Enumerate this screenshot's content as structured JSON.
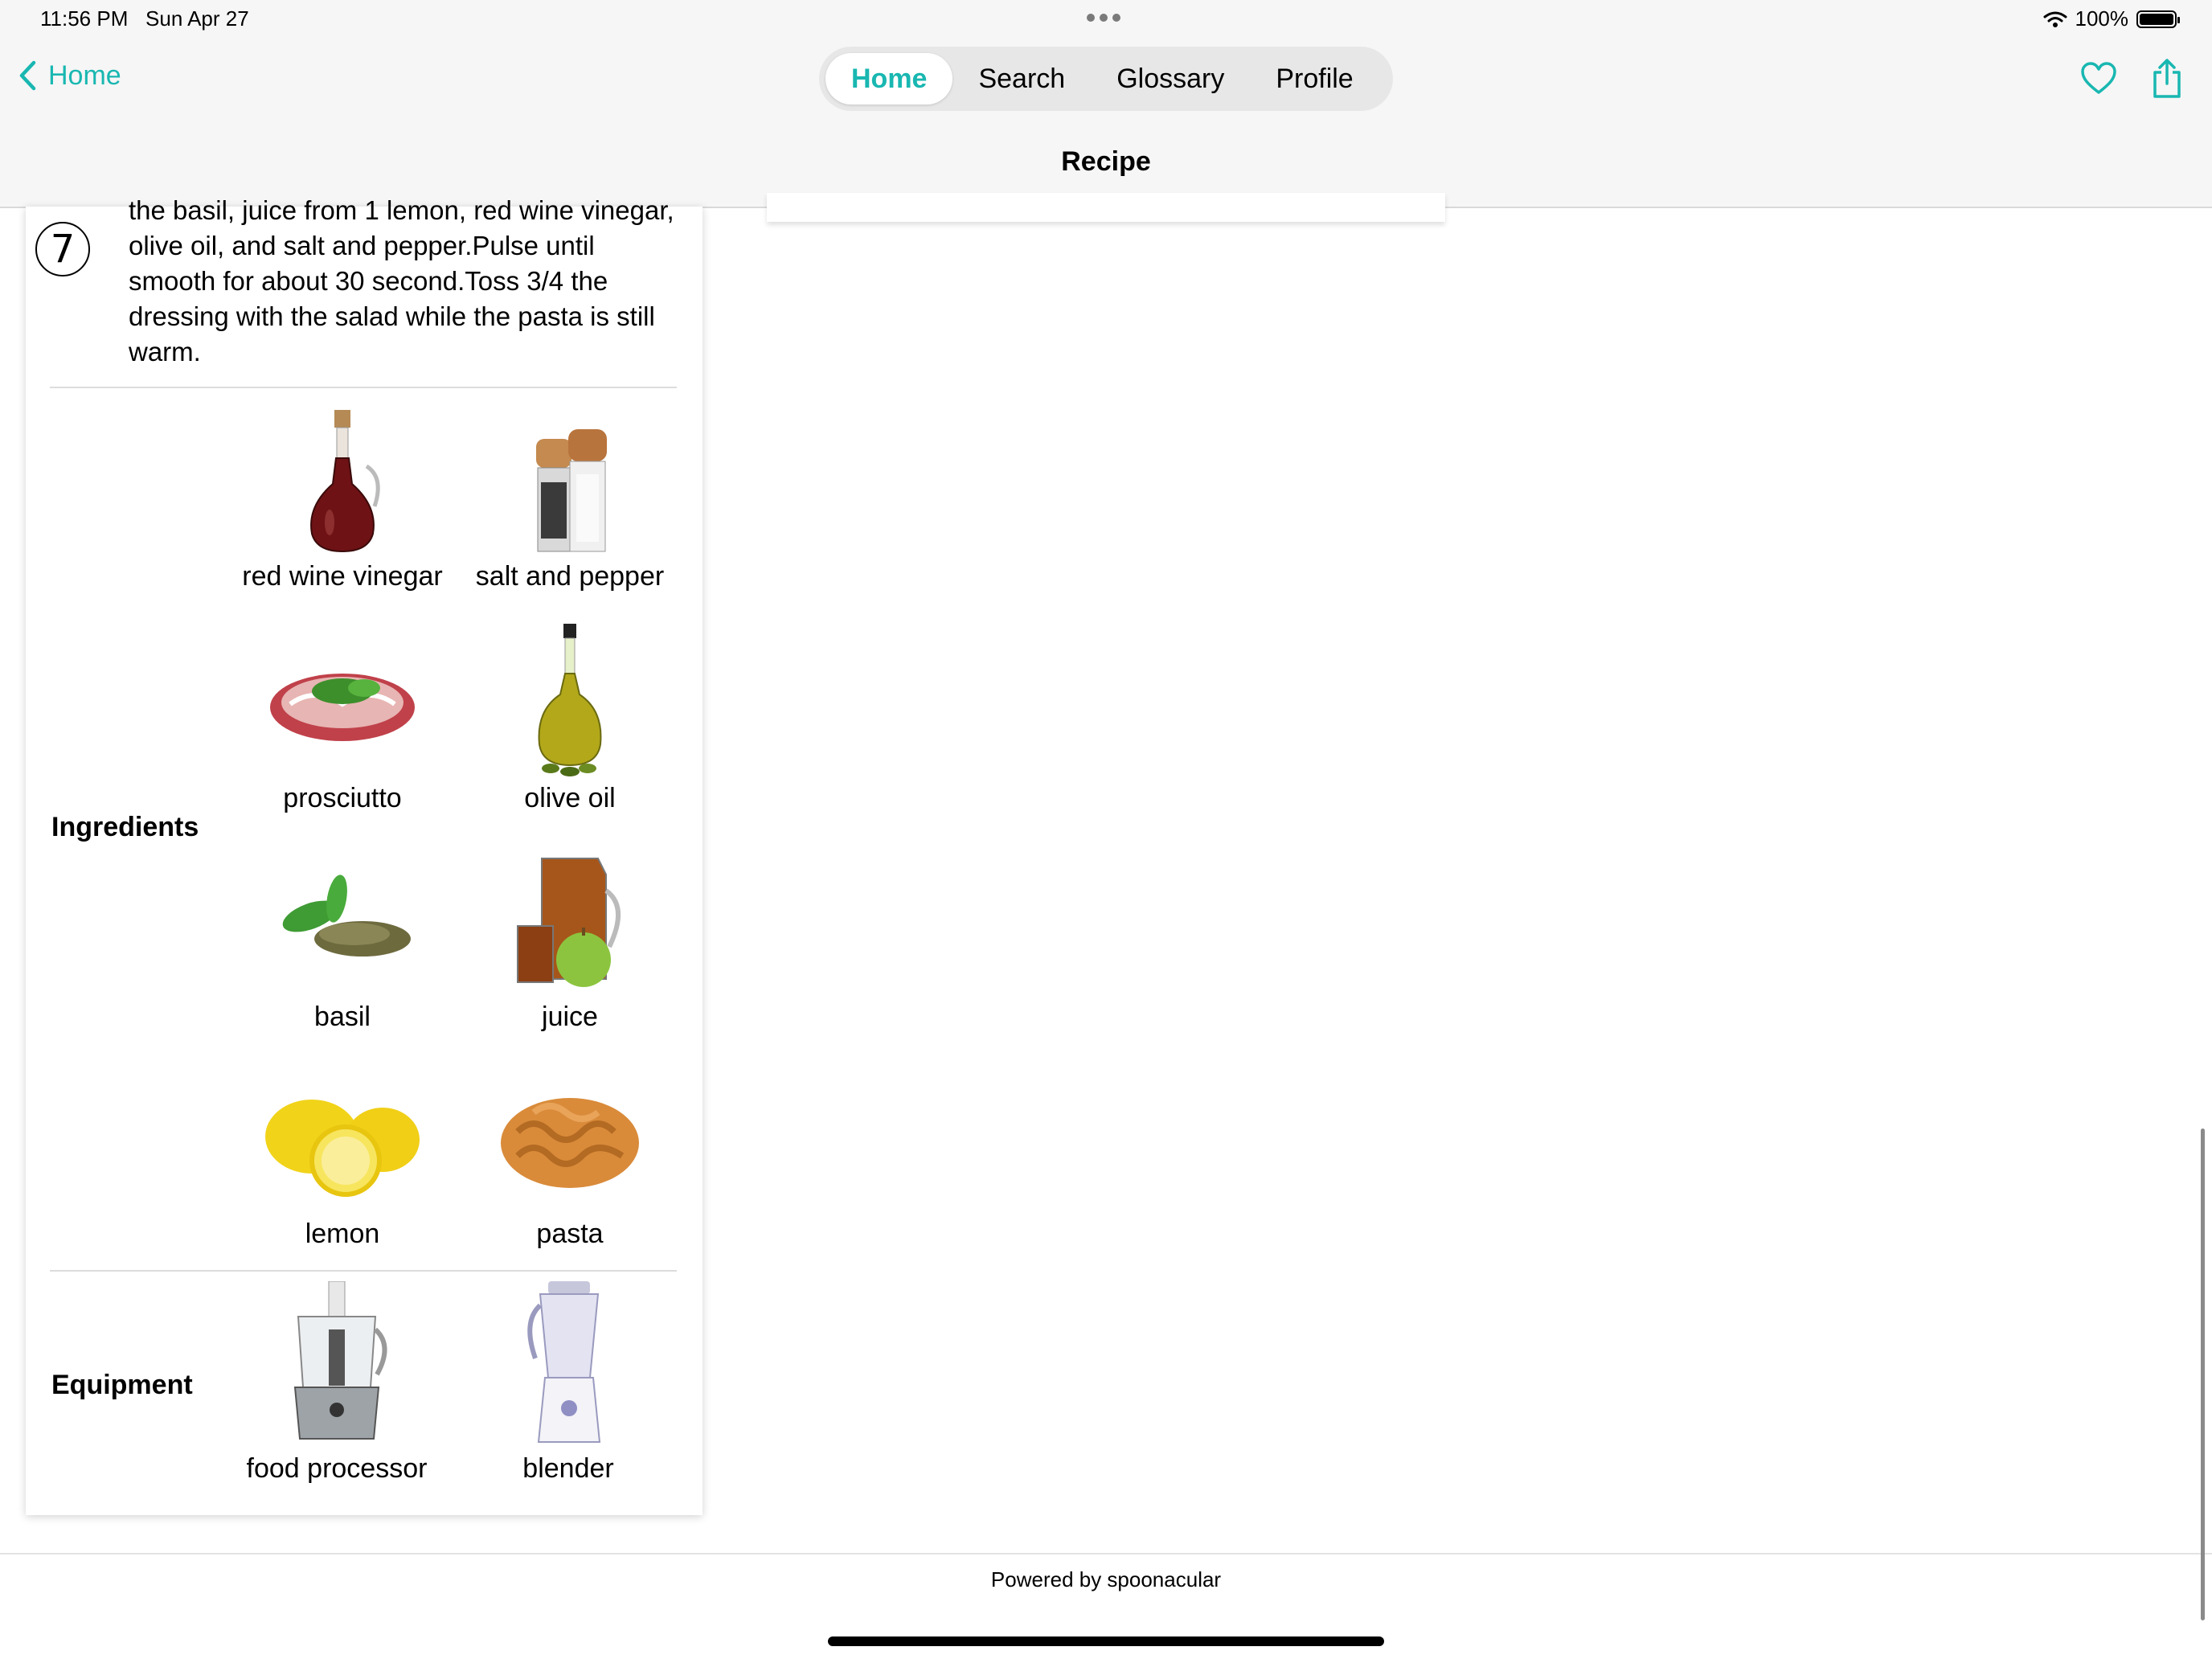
{
  "status_bar": {
    "time": "11:56 PM",
    "date": "Sun Apr 27",
    "battery": "100%"
  },
  "nav": {
    "back_label": "Home",
    "tabs": [
      {
        "label": "Home",
        "active": true
      },
      {
        "label": "Search"
      },
      {
        "label": "Glossary"
      },
      {
        "label": "Profile"
      }
    ],
    "title": "Recipe",
    "icons": [
      "heart-icon",
      "share-icon"
    ]
  },
  "step": {
    "number": "7",
    "text": "the basil, juice from 1 lemon, red wine vinegar, olive oil, and salt and pepper.Pulse until smooth for about 30 second.Toss 3/4 the dressing with the salad while the pasta is still warm."
  },
  "ingredients": {
    "heading": "Ingredients",
    "items": [
      {
        "name": "red wine vinegar"
      },
      {
        "name": "salt and pepper"
      },
      {
        "name": "prosciutto"
      },
      {
        "name": "olive oil"
      },
      {
        "name": "basil"
      },
      {
        "name": "juice"
      },
      {
        "name": "lemon"
      },
      {
        "name": "pasta"
      }
    ]
  },
  "equipment": {
    "heading": "Equipment",
    "items": [
      {
        "name": "food processor"
      },
      {
        "name": "blender"
      }
    ]
  },
  "footer": {
    "text": "Powered by spoonacular"
  },
  "colors": {
    "accent": "#19b7b1"
  }
}
